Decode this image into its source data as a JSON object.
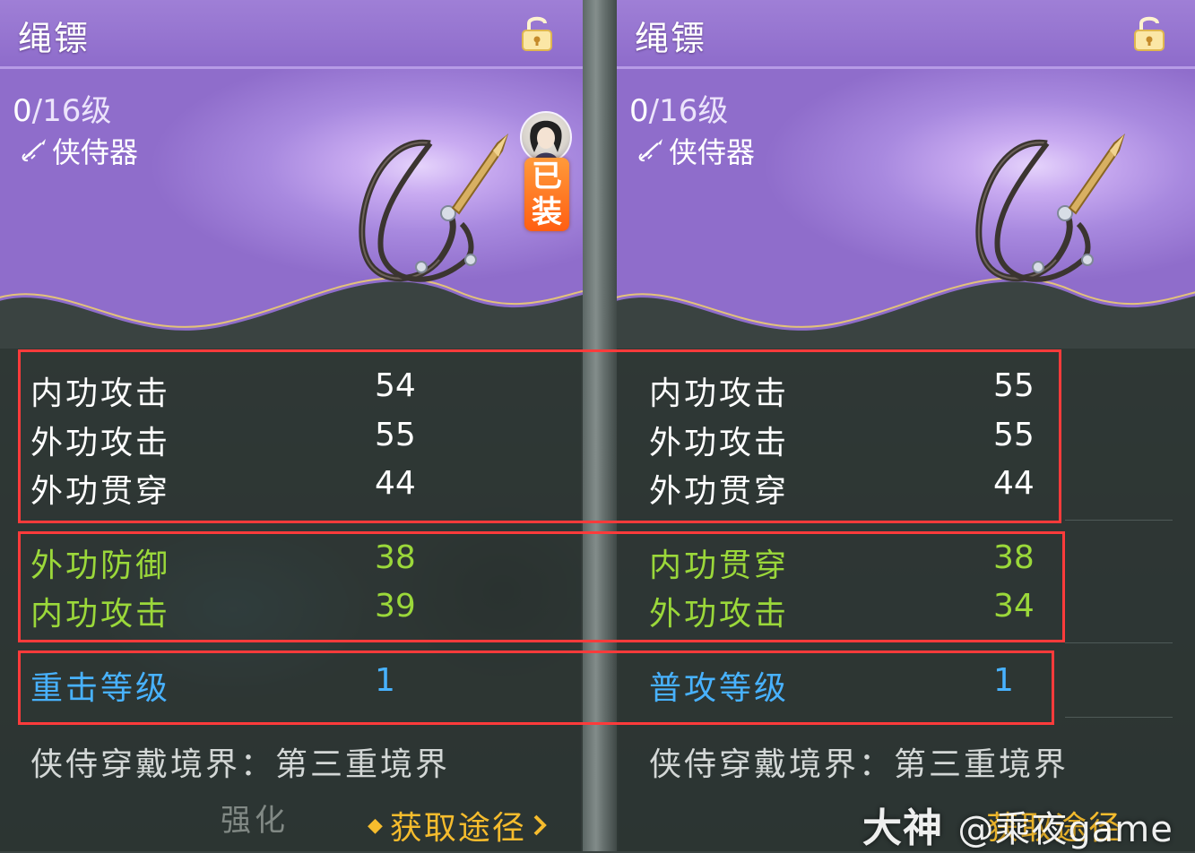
{
  "left": {
    "title": "绳镖",
    "level_current": "0",
    "level_total": "/16级",
    "category": "侠侍器",
    "equipped_badge": [
      "已",
      "装"
    ],
    "stats_main": [
      {
        "name": "内功攻击",
        "value": "54"
      },
      {
        "name": "外功攻击",
        "value": "55"
      },
      {
        "name": "外功贯穿",
        "value": "44"
      }
    ],
    "stats_bonus": [
      {
        "name": "外功防御",
        "value": "38"
      },
      {
        "name": "内功攻击",
        "value": "39"
      }
    ],
    "stats_special": [
      {
        "name": "重击等级",
        "value": "1"
      }
    ],
    "wear_requirement": "侠侍穿戴境界：第三重境界",
    "acquire_label": "获取途径",
    "enhance_label": "强化"
  },
  "right": {
    "title": "绳镖",
    "level_current": "0",
    "level_total": "/16级",
    "category": "侠侍器",
    "stats_main": [
      {
        "name": "内功攻击",
        "value": "55"
      },
      {
        "name": "外功攻击",
        "value": "55"
      },
      {
        "name": "外功贯穿",
        "value": "44"
      }
    ],
    "stats_bonus": [
      {
        "name": "内功贯穿",
        "value": "38"
      },
      {
        "name": "外功攻击",
        "value": "34"
      }
    ],
    "stats_special": [
      {
        "name": "普攻等级",
        "value": "1"
      }
    ],
    "wear_requirement": "侠侍穿戴境界：第三重境界",
    "acquire_label": "获取途径"
  },
  "watermark": {
    "brand": "大神",
    "handle": "@乘夜game"
  },
  "colors": {
    "main_stat": "#ffffff",
    "bonus_stat": "#9bd83a",
    "special_stat": "#48b2ff",
    "highlight_box": "#ff3b3b",
    "acquire": "#f6bc2d",
    "header": "#9a7ad3"
  },
  "icons": {
    "lock": "unlocked-padlock-icon",
    "category": "dart-icon",
    "acquire": "diamond-bullet-icon",
    "acquire_arrow": "chevron-right-icon"
  }
}
